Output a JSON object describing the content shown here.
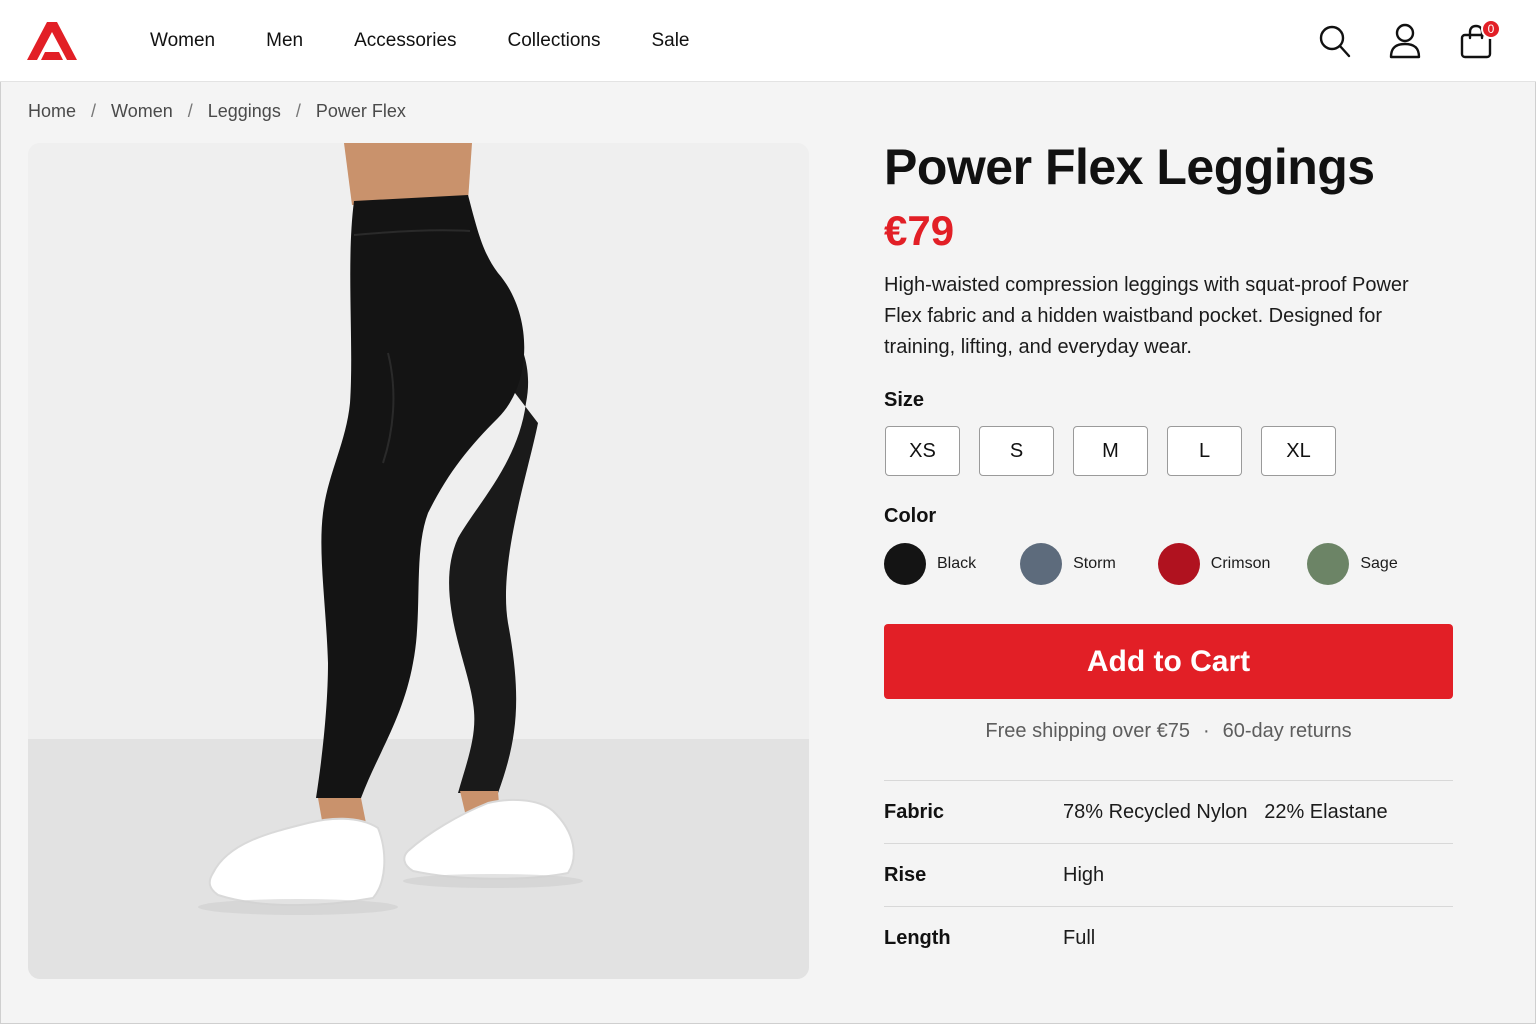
{
  "header": {
    "nav": [
      "Women",
      "Men",
      "Accessories",
      "Collections",
      "Sale"
    ],
    "cart_count": "0",
    "icons": [
      "search-icon",
      "account-icon",
      "shopping-bag-icon"
    ],
    "brand_color": "#e21f26"
  },
  "breadcrumb": [
    "Home",
    "Women",
    "Leggings",
    "Power Flex"
  ],
  "product": {
    "title": "Power Flex Leggings",
    "price": "€79",
    "description": "High-waisted compression leggings with squat-proof Power Flex fabric and a hidden waistband pocket. Designed for training, lifting, and everyday wear.",
    "size_label": "Size",
    "sizes": [
      "XS",
      "S",
      "M",
      "L",
      "XL"
    ],
    "color_label": "Color",
    "colors": [
      {
        "name": "Black",
        "hex": "#141414"
      },
      {
        "name": "Storm",
        "hex": "#5d6b7c"
      },
      {
        "name": "Crimson",
        "hex": "#b0121f"
      },
      {
        "name": "Sage",
        "hex": "#6c8466"
      }
    ],
    "cta": "Add to Cart",
    "perks": [
      "Free shipping over €75",
      "60-day returns"
    ],
    "specs": [
      {
        "key": "Fabric",
        "value": "78% Recycled Nylon   22% Elastane"
      },
      {
        "key": "Rise",
        "value": "High"
      },
      {
        "key": "Length",
        "value": "Full"
      }
    ]
  }
}
